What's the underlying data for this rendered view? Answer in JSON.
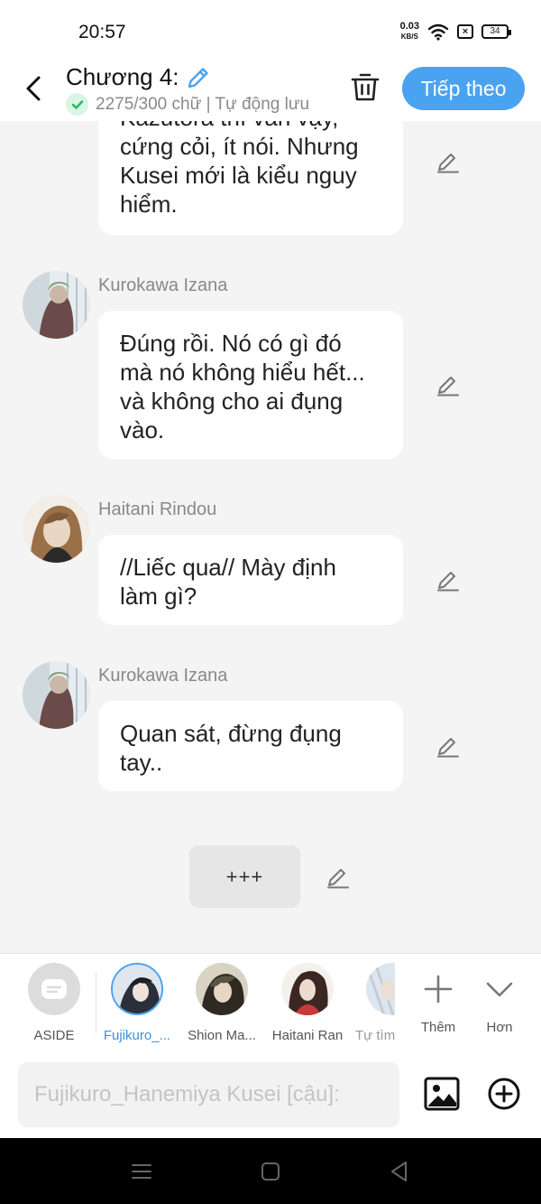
{
  "status_bar": {
    "time": "20:57",
    "net_speed": "0.03",
    "net_unit": "KB/S",
    "sim_status": "×",
    "battery": "34"
  },
  "header": {
    "title": "Chương 4:",
    "word_count": "2275/300 chữ | Tự động lưu",
    "next_label": "Tiếp theo"
  },
  "messages": [
    {
      "sender": "",
      "lines": [
        "Kazutora thì vẫn vậy,",
        "cứng cỏi, ít nói. Nhưng",
        "Kusei mới là kiểu nguy",
        "hiểm."
      ]
    },
    {
      "sender": "Kurokawa Izana",
      "lines": [
        "Đúng rồi. Nó có gì đó",
        "mà nó không hiểu hết...",
        "và không cho ai đụng",
        "vào."
      ]
    },
    {
      "sender": "Haitani Rindou",
      "lines": [
        "//Liếc qua// Mày định",
        "làm gì?"
      ]
    },
    {
      "sender": "Kurokawa Izana",
      "lines": [
        "Quan sát, đừng đụng",
        "tay.."
      ]
    }
  ],
  "separator": "+++",
  "character_bar": {
    "items": [
      {
        "label": "ASIDE"
      },
      {
        "label": "Fujikuro_..."
      },
      {
        "label": "Shion Ma..."
      },
      {
        "label": "Haitani Ran"
      },
      {
        "label": "Tự tìm"
      }
    ],
    "more_label": "Thêm",
    "expand_label": "Hơn"
  },
  "composer": {
    "placeholder": "Fujikuro_Hanemiya Kusei [cậu]:"
  },
  "colors": {
    "accent": "#4aa3f0",
    "active_label": "#3a90e0",
    "check_green": "#2fb564"
  }
}
